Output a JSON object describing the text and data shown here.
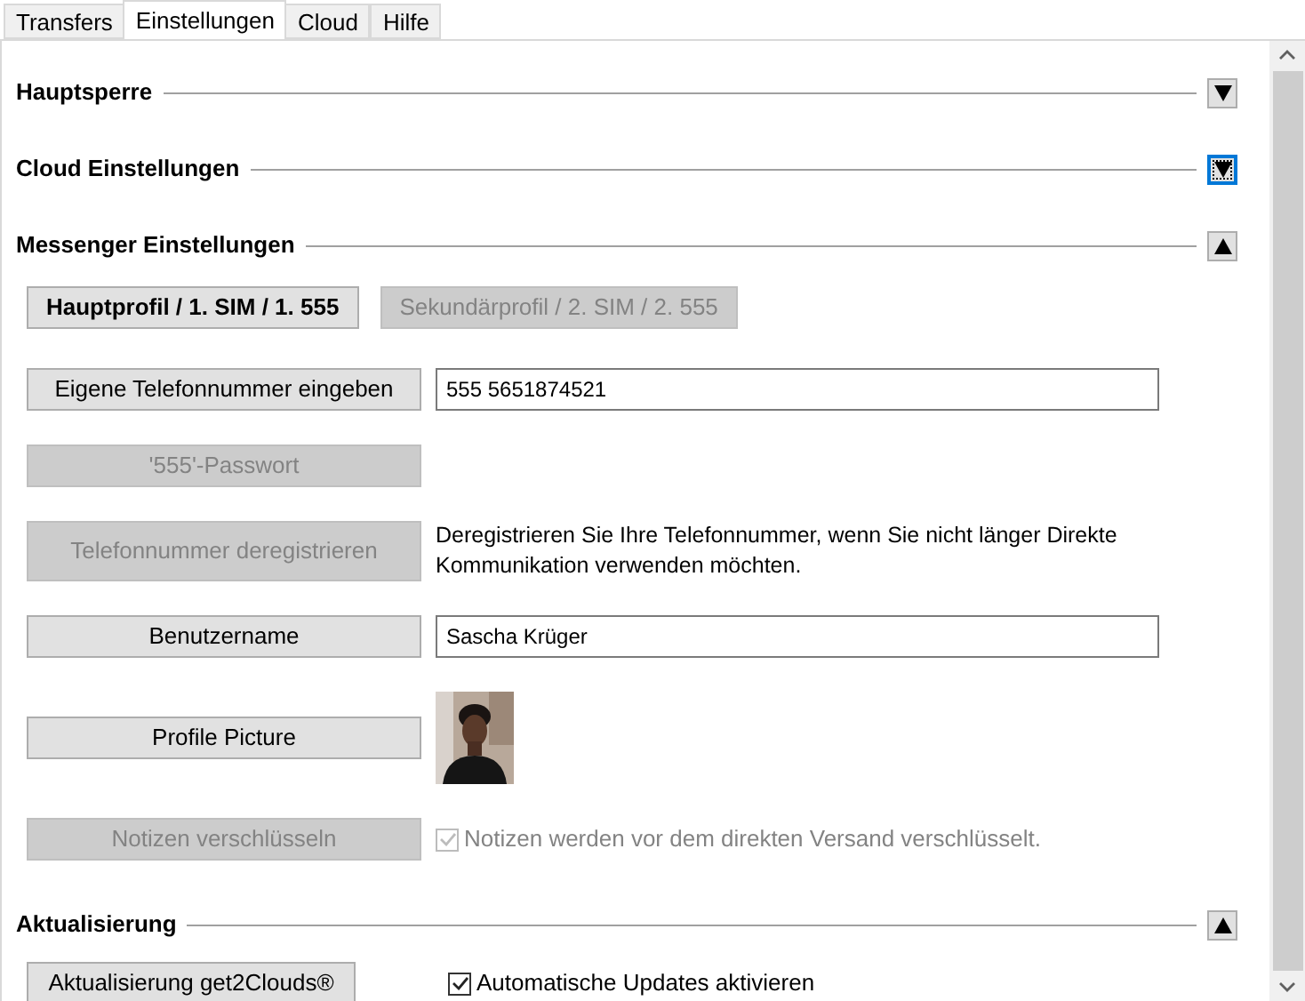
{
  "tabs": [
    {
      "label": "Transfers",
      "selected": false
    },
    {
      "label": "Einstellungen",
      "selected": true
    },
    {
      "label": "Cloud",
      "selected": false
    },
    {
      "label": "Hilfe",
      "selected": false
    }
  ],
  "sections": [
    {
      "title": "Hauptsperre",
      "expanded": false,
      "focused": false
    },
    {
      "title": "Cloud Einstellungen",
      "expanded": false,
      "focused": true
    },
    {
      "title": "Messenger Einstellungen",
      "expanded": true,
      "focused": false,
      "rows": [
        {
          "kind": "profiles",
          "buttons": [
            {
              "label": "Hauptprofil / 1. SIM / 1. 555",
              "selected": true
            },
            {
              "label": "Sekundärprofil / 2. SIM / 2. 555",
              "selected": false
            }
          ]
        },
        {
          "kind": "field",
          "button": {
            "label": "Eigene Telefonnummer eingeben",
            "disabled": false
          },
          "value": "555 5651874521"
        },
        {
          "kind": "button",
          "button": {
            "label": "'555'-Passwort",
            "disabled": true
          }
        },
        {
          "kind": "text",
          "button": {
            "label": "Telefonnummer deregistrieren",
            "disabled": true
          },
          "text": "Deregistrieren Sie Ihre Telefonnummer, wenn Sie nicht länger Direkte Kommunikation verwenden möchten."
        },
        {
          "kind": "field",
          "button": {
            "label": "Benutzername",
            "disabled": false
          },
          "value": "Sascha Krüger"
        },
        {
          "kind": "picture",
          "button": {
            "label": "Profile Picture",
            "disabled": false
          }
        },
        {
          "kind": "checkbox",
          "button": {
            "label": "Notizen verschlüsseln",
            "disabled": true
          },
          "checkbox": {
            "label": "Notizen werden vor dem direkten Versand verschlüsselt.",
            "checked": true,
            "disabled": true
          }
        }
      ]
    },
    {
      "title": "Aktualisierung",
      "expanded": true,
      "focused": false,
      "rows": [
        {
          "kind": "checkbox",
          "button": {
            "label": "Aktualisierung get2Clouds®",
            "disabled": false
          },
          "checkbox": {
            "label": "Automatische Updates aktivieren",
            "checked": true,
            "disabled": false
          }
        }
      ]
    }
  ]
}
